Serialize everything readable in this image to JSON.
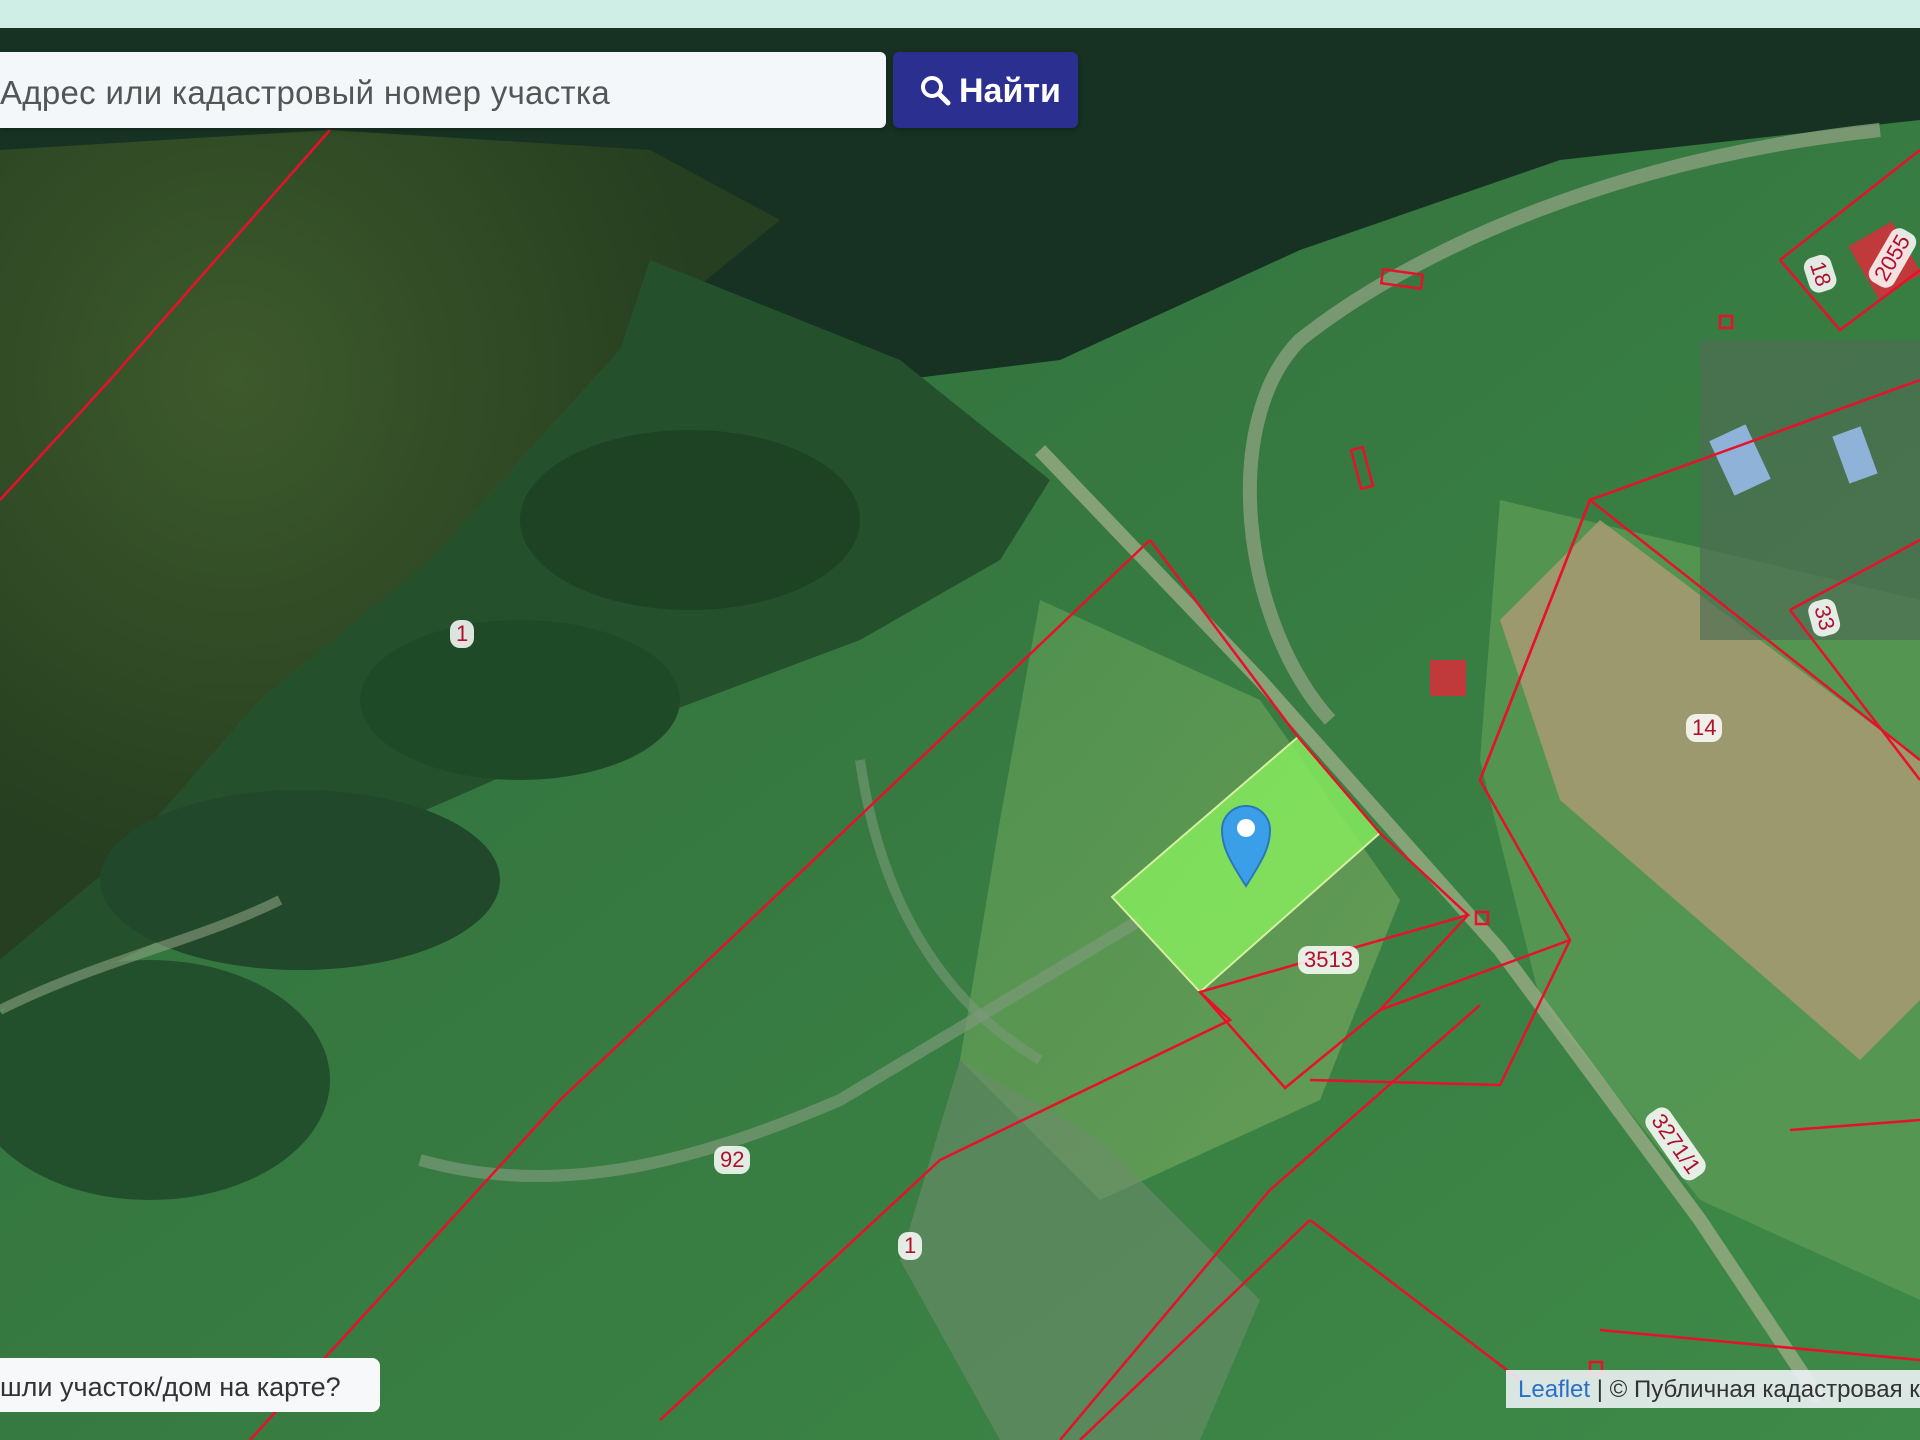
{
  "search": {
    "placeholder": "Адрес или кадастровый номер участка",
    "button_label": "Найти",
    "button_icon": "search-icon"
  },
  "map_help": {
    "text": "шли участок/дом на карте?"
  },
  "attribution": {
    "leaflet": "Leaflet",
    "separator": " | ",
    "source": "© Публичная кадастровая к"
  },
  "parcels": {
    "p1_top": "1",
    "p92": "92",
    "p1_bottom": "1",
    "p3513": "3513",
    "p14": "14",
    "p33": "33",
    "p18": "18",
    "p2055": "2055",
    "p3271": "3271/1"
  },
  "colors": {
    "boundary": "#e8102a",
    "selected_fill": "#7ee05a",
    "marker": "#3a9ee8",
    "button": "#2b2f8f"
  }
}
